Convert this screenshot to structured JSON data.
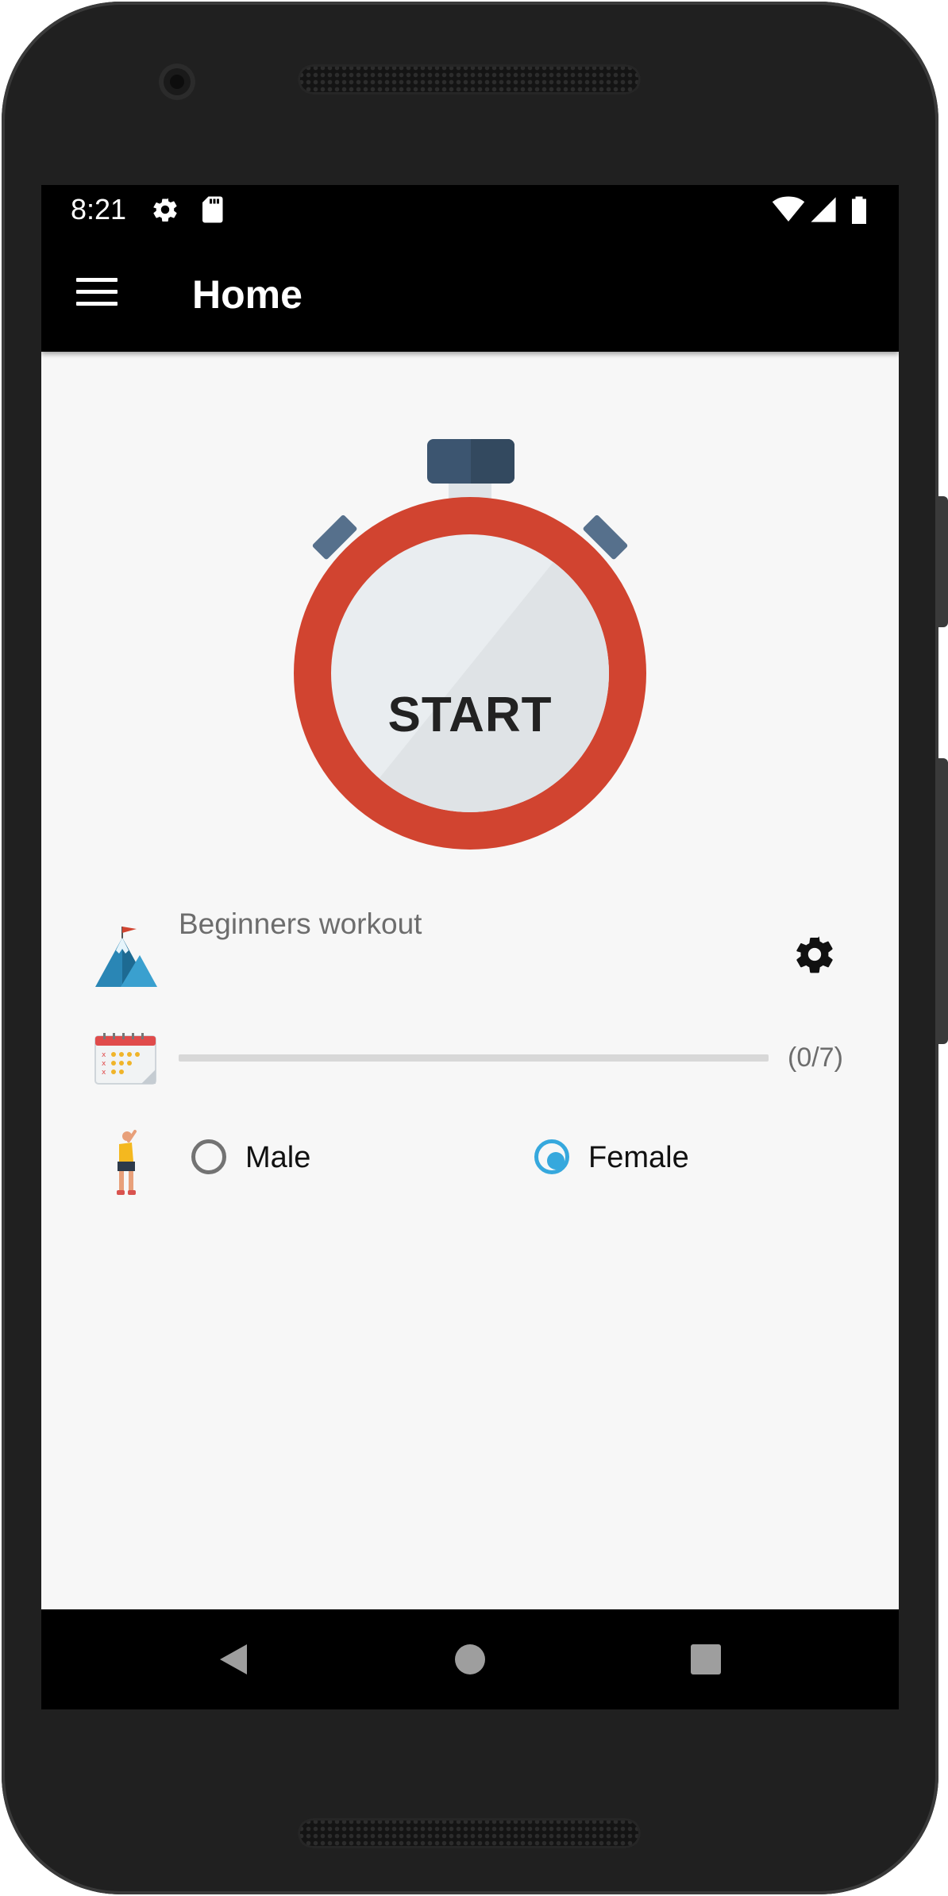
{
  "status_bar": {
    "time": "8:21",
    "left_icons": [
      "gear-icon",
      "sd-card-icon"
    ],
    "right_icons": [
      "wifi-icon",
      "signal-icon",
      "battery-icon"
    ]
  },
  "app_bar": {
    "menu_icon": "hamburger-menu-icon",
    "title": "Home"
  },
  "stopwatch": {
    "label": "START",
    "ring_color": "#d14430",
    "face_color": "#e9edf0",
    "crown_color": "#3c5570"
  },
  "workout": {
    "icon": "mountain-flag-icon",
    "name": "Beginners workout",
    "settings_icon": "gear-icon"
  },
  "progress": {
    "icon": "calendar-icon",
    "completed": 0,
    "total": 7,
    "count_text": "(0/7)"
  },
  "gender": {
    "icon": "person-stretching-icon",
    "options": [
      {
        "label": "Male",
        "checked": false
      },
      {
        "label": "Female",
        "checked": true
      }
    ]
  },
  "nav_bar": {
    "buttons": [
      "back-triangle-icon",
      "home-circle-icon",
      "recents-square-icon"
    ]
  },
  "colors": {
    "accent": "#36a8dd",
    "screen_bg": "#f7f7f7",
    "bar_bg": "#000000"
  }
}
